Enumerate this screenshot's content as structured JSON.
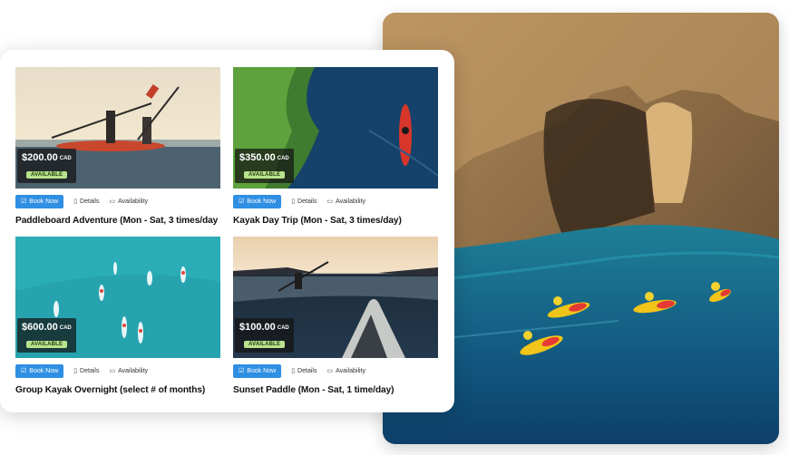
{
  "listings": [
    {
      "price": "$200.00",
      "currency": "CAD",
      "status": "AVAILABLE",
      "book_label": "Book Now",
      "details_label": "Details",
      "availability_label": "Availability",
      "title": "Paddleboard Adventure (Mon - Sat, 3 times/day"
    },
    {
      "price": "$350.00",
      "currency": "CAD",
      "status": "AVAILABLE",
      "book_label": "Book Now",
      "details_label": "Details",
      "availability_label": "Availability",
      "title": "Kayak Day Trip (Mon - Sat, 3 times/day)"
    },
    {
      "price": "$600.00",
      "currency": "CAD",
      "status": "AVAILABLE",
      "book_label": "Book Now",
      "details_label": "Details",
      "availability_label": "Availability",
      "title": "Group Kayak Overnight (select # of months)"
    },
    {
      "price": "$100.00",
      "currency": "CAD",
      "status": "AVAILABLE",
      "book_label": "Book Now",
      "details_label": "Details",
      "availability_label": "Availability",
      "title": "Sunset Paddle (Mon - Sat, 1 time/day)"
    }
  ],
  "icons": {
    "book": "check-square-icon",
    "details": "document-icon",
    "availability": "calendar-icon"
  },
  "colors": {
    "book_button": "#2f8fe3",
    "badge": "#b9e28c",
    "price_overlay": "#141414"
  }
}
